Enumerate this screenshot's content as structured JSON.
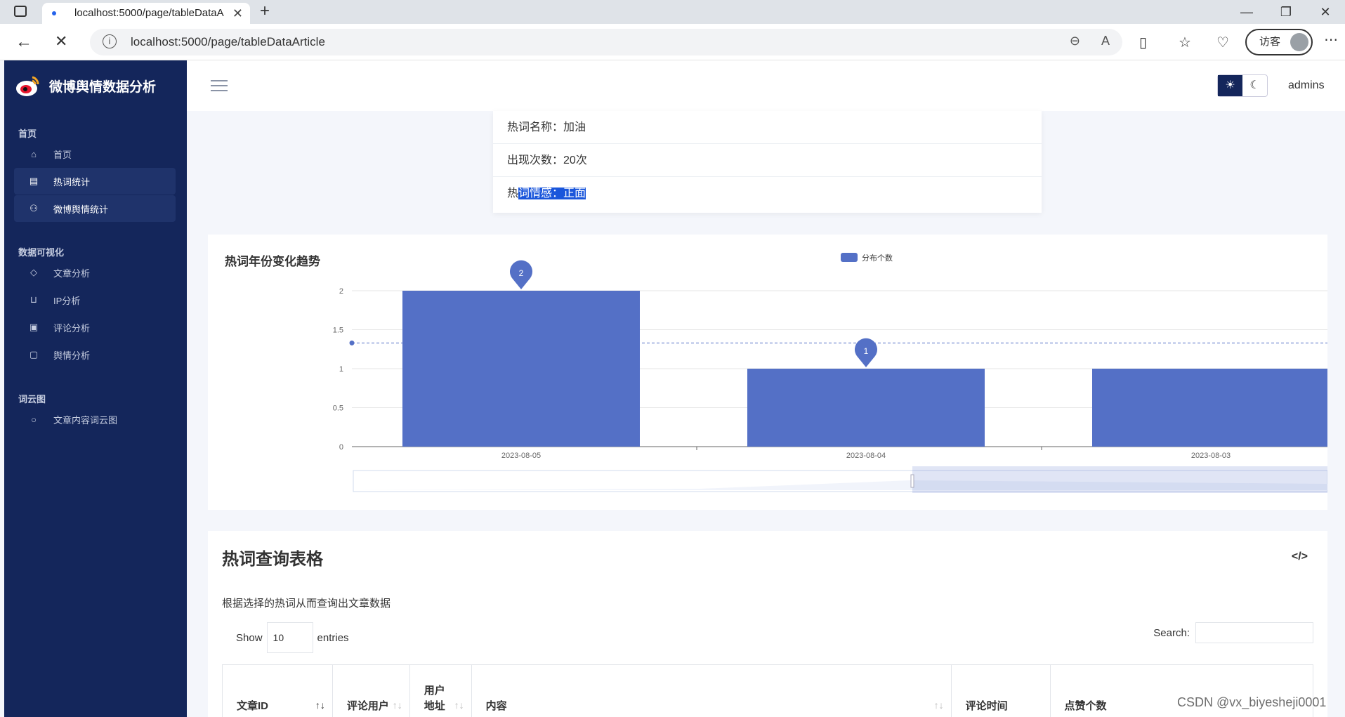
{
  "browser": {
    "tab_title": "localhost:5000/page/tableDataA",
    "url": "localhost:5000/page/tableDataArticle",
    "visitor_label": "访客"
  },
  "sidebar": {
    "brand": "微博舆情数据分析",
    "sections": [
      {
        "label": "首页",
        "items": [
          {
            "label": "首页",
            "icon": "home-icon"
          },
          {
            "label": "热词统计",
            "icon": "table-icon",
            "active": true
          },
          {
            "label": "微博舆情统计",
            "icon": "users-icon",
            "active": true
          }
        ]
      },
      {
        "label": "数据可视化",
        "items": [
          {
            "label": "文章分析",
            "icon": "tag-icon"
          },
          {
            "label": "IP分析",
            "icon": "cart-icon"
          },
          {
            "label": "评论分析",
            "icon": "chart-icon"
          },
          {
            "label": "舆情分析",
            "icon": "clipboard-icon"
          }
        ]
      },
      {
        "label": "词云图",
        "items": [
          {
            "label": "文章内容词云图",
            "icon": "comment-icon"
          }
        ]
      }
    ]
  },
  "header": {
    "user": "admins"
  },
  "info": {
    "name_label": "热词名称：",
    "name_value": "加油",
    "count_label": "出现次数：",
    "count_value": "20次",
    "sentiment_prefix": "热",
    "sentiment_label_rest": "词情感：",
    "sentiment_value": "正面"
  },
  "chart_data": {
    "type": "bar",
    "title": "热词年份变化趋势",
    "legend": "分布个数",
    "legend_position": "top-center",
    "categories": [
      "2023-08-05",
      "2023-08-04",
      "2023-08-03"
    ],
    "series": [
      {
        "name": "分布个数",
        "values": [
          2,
          1,
          1
        ]
      }
    ],
    "ylim": [
      0,
      2
    ],
    "yticks": [
      "0",
      "0.5",
      "1",
      "1.5",
      "2"
    ],
    "markpoints": [
      {
        "category": "2023-08-05",
        "value": "2"
      },
      {
        "category": "2023-08-04",
        "value": "1"
      }
    ],
    "average_line": 1.33,
    "color": "#5470c6"
  },
  "table": {
    "title": "热词查询表格",
    "code_icon": "</>",
    "description": "根据选择的热词从而查询出文章数据",
    "show_label": "Show",
    "entries_value": "10",
    "entries_label": "entries",
    "search_label": "Search:",
    "columns": [
      "文章ID",
      "评论用户",
      "用户地址",
      "内容",
      "评论时间",
      "点赞个数"
    ]
  },
  "watermark": "CSDN @vx_biyesheji0001"
}
